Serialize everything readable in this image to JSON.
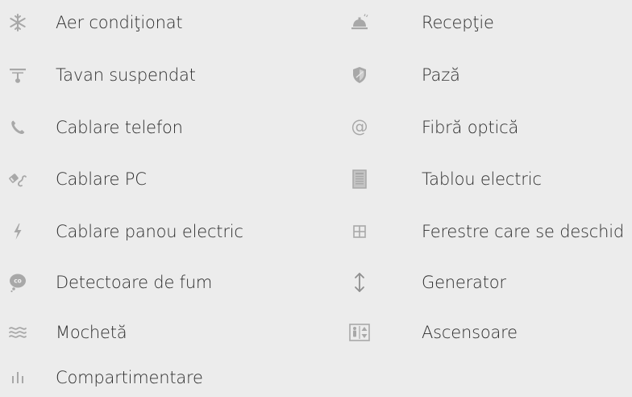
{
  "left_column": [
    {
      "label": "Aer condiţionat",
      "icon": "snowflake-icon"
    },
    {
      "label": "Tavan suspendat",
      "icon": "ceiling-lamp-icon"
    },
    {
      "label": "Cablare telefon",
      "icon": "phone-icon"
    },
    {
      "label": "Cablare PC",
      "icon": "network-cable-icon"
    },
    {
      "label": "Cablare panou electric",
      "icon": "lightning-icon"
    },
    {
      "label": "Detectoare de fum",
      "icon": "smoke-detector-icon"
    },
    {
      "label": "Mochetă",
      "icon": "carpet-waves-icon"
    },
    {
      "label": "Compartimentare",
      "icon": "partition-icon"
    }
  ],
  "right_column": [
    {
      "label": "Recepţie",
      "icon": "reception-bell-icon"
    },
    {
      "label": "Pază",
      "icon": "security-shield-icon"
    },
    {
      "label": "Fibră optică",
      "icon": "at-sign-icon"
    },
    {
      "label": "Tablou electric",
      "icon": "electrical-panel-icon"
    },
    {
      "label": "Ferestre care se deschid",
      "icon": "window-icon"
    },
    {
      "label": "Generator",
      "icon": "up-down-arrow-icon"
    },
    {
      "label": "Ascensoare",
      "icon": "elevator-icon"
    }
  ],
  "colors": {
    "background": "#ececec",
    "text": "#2e2e2e",
    "icon": "#a9a9a9"
  }
}
